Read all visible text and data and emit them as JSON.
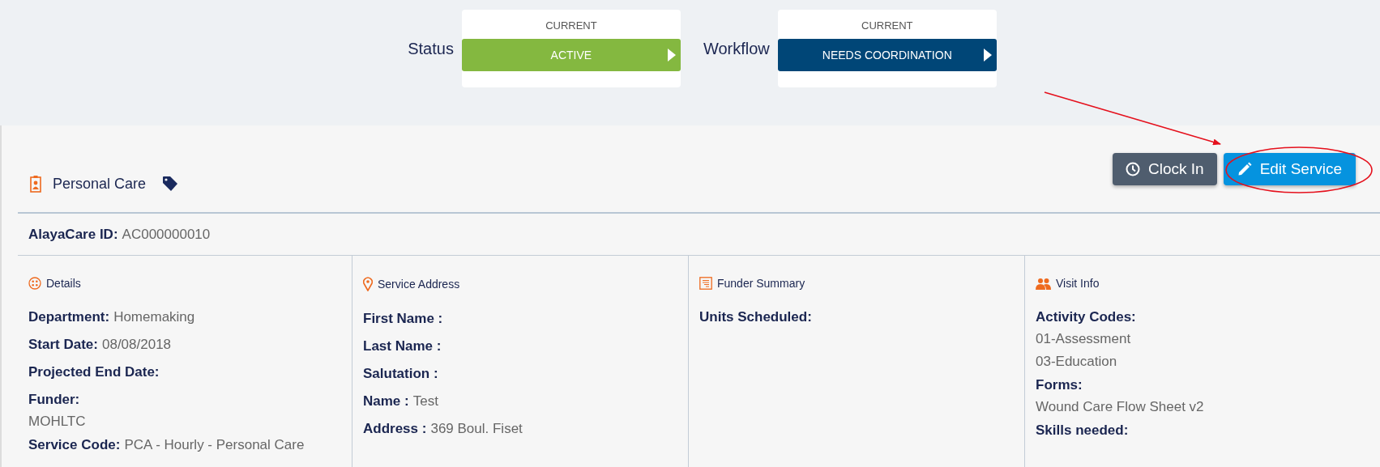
{
  "status_cards": [
    {
      "label": "Status",
      "caption": "CURRENT",
      "value": "ACTIVE",
      "color": "#84b840"
    },
    {
      "label": "Workflow",
      "caption": "CURRENT",
      "value": "NEEDS COORDINATION",
      "color": "#004677"
    }
  ],
  "service": {
    "title": "Personal Care"
  },
  "buttons": [
    {
      "label": "Clock In",
      "kind": "clock"
    },
    {
      "label": "Edit Service",
      "kind": "edit"
    }
  ],
  "id_field": {
    "label": "AlayaCare ID:",
    "value": "AC000000010"
  },
  "sections": [
    {
      "title": "Details",
      "kind": "details",
      "fields": [
        {
          "label": "Department:",
          "kind": "inline",
          "values": [
            "Homemaking"
          ]
        },
        {
          "label": "Start Date:",
          "kind": "inline",
          "values": [
            "08/08/2018"
          ]
        },
        {
          "label": "Projected End Date:",
          "kind": "inline"
        },
        {
          "label": "Funder:",
          "kind": "stacked",
          "values": [
            "MOHLTC"
          ]
        },
        {
          "label": "Service Code:",
          "kind": "inline",
          "values": [
            "PCA - Hourly - Personal Care"
          ]
        }
      ]
    },
    {
      "title": "Service Address",
      "kind": "address",
      "fields": [
        {
          "label": "First Name :",
          "kind": "inline"
        },
        {
          "label": "Last Name :",
          "kind": "inline"
        },
        {
          "label": "Salutation :",
          "kind": "inline"
        },
        {
          "label": "Name :",
          "kind": "inline",
          "values": [
            "Test"
          ]
        },
        {
          "label": "Address :",
          "kind": "inline",
          "values": [
            "369 Boul. Fiset"
          ]
        }
      ]
    },
    {
      "title": "Funder Summary",
      "kind": "funder",
      "fields": [
        {
          "label": "Units Scheduled:",
          "kind": "inline"
        }
      ]
    },
    {
      "title": "Visit Info",
      "kind": "visit",
      "fields": [
        {
          "label": "Activity Codes:",
          "kind": "stacked",
          "values": [
            "01-Assessment",
            "03-Education"
          ]
        },
        {
          "label": "Forms:",
          "kind": "stacked",
          "values": [
            "Wound Care Flow Sheet v2"
          ]
        },
        {
          "label": "Skills needed:",
          "kind": "stacked"
        }
      ]
    }
  ]
}
